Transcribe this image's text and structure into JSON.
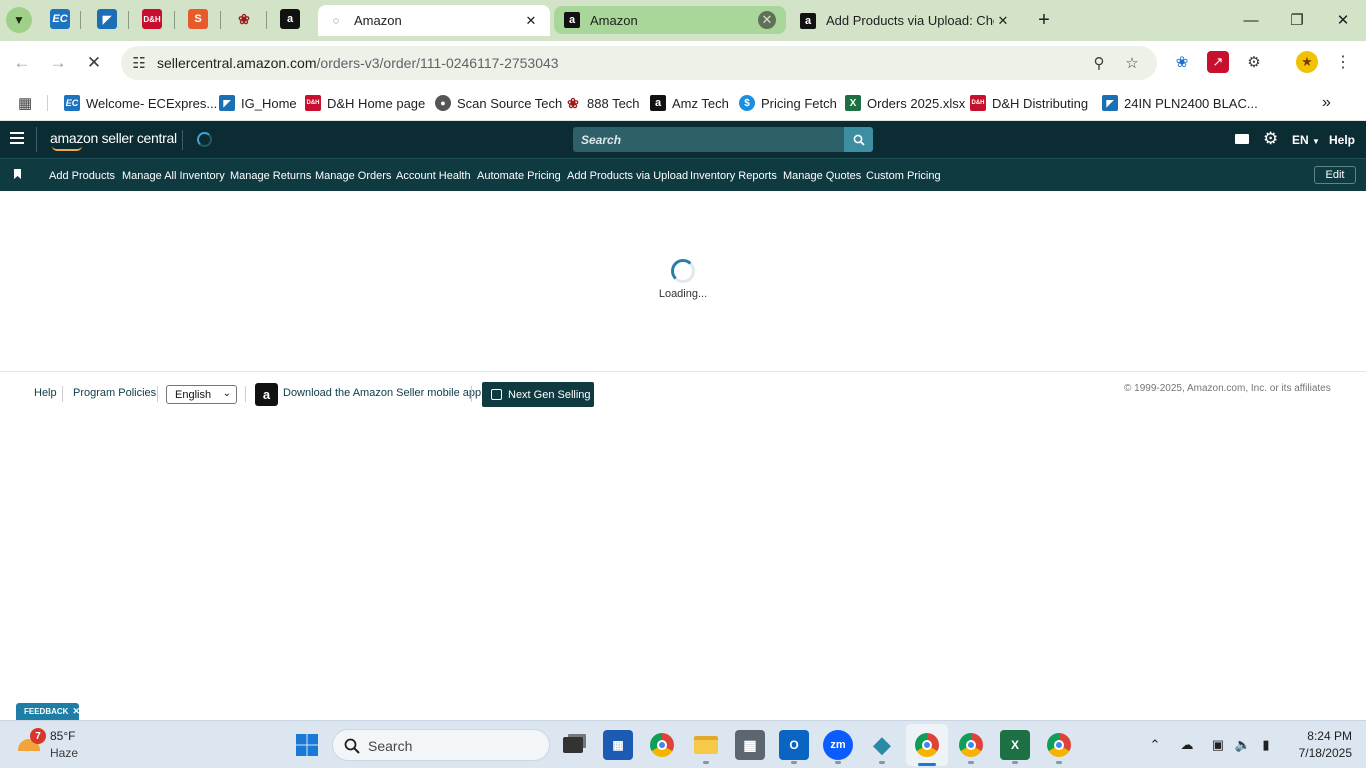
{
  "browser": {
    "tabs": [
      {
        "label": "Amazon",
        "active": true
      },
      {
        "label": "Amazon",
        "highlight": true
      },
      {
        "label": "Add Products via Upload: Check"
      }
    ],
    "url_domain": "sellercentral.amazon.com",
    "url_path": "/orders-v3/order/111-0246117-2753043"
  },
  "bookmarks": [
    {
      "label": "Welcome- ECExpres...",
      "icon": "ec-logo-icon",
      "color": "#1e73be"
    },
    {
      "label": "IG_Home",
      "icon": "ingram-icon",
      "color": "#1a6fb5"
    },
    {
      "label": "D&H Home page",
      "icon": "dh-logo-icon",
      "color": "#c8102e"
    },
    {
      "label": "Scan Source Tech",
      "icon": "globe-icon",
      "color": "#555555"
    },
    {
      "label": "888 Tech",
      "icon": "888-icon",
      "color": "#b02020"
    },
    {
      "label": "Amz Tech",
      "icon": "amazon-icon",
      "color": "#222222"
    },
    {
      "label": "Pricing Fetch",
      "icon": "dollar-icon",
      "color": "#1a8fe0"
    },
    {
      "label": "Orders 2025.xlsx",
      "icon": "excel-icon",
      "color": "#1d7044"
    },
    {
      "label": "D&H Distributing",
      "icon": "dh-logo-icon",
      "color": "#c8102e"
    },
    {
      "label": "24IN PLN2400 BLAC...",
      "icon": "ingram-icon",
      "color": "#1a6fb5"
    }
  ],
  "seller": {
    "logo": "amazon seller central",
    "search_placeholder": "Search",
    "language": "EN",
    "help": "Help",
    "nav": [
      "Add Products",
      "Manage All Inventory",
      "Manage Returns",
      "Manage Orders",
      "Account Health",
      "Automate Pricing",
      "Add Products via Upload",
      "Inventory Reports",
      "Manage Quotes",
      "Custom Pricing"
    ],
    "edit": "Edit",
    "loading": "Loading..."
  },
  "footer": {
    "help": "Help",
    "program_policies": "Program Policies",
    "language_selected": "English",
    "download_app": "Download the Amazon Seller mobile app",
    "next_gen": "Next Gen Selling",
    "copyright": "© 1999-2025, Amazon.com, Inc. or its affiliates",
    "feedback": "FEEDBACK"
  },
  "taskbar": {
    "weather_temp": "85°F",
    "weather_desc": "Haze",
    "weather_badge": "7",
    "search_placeholder": "Search",
    "time": "8:24 PM",
    "date": "7/18/2025"
  }
}
